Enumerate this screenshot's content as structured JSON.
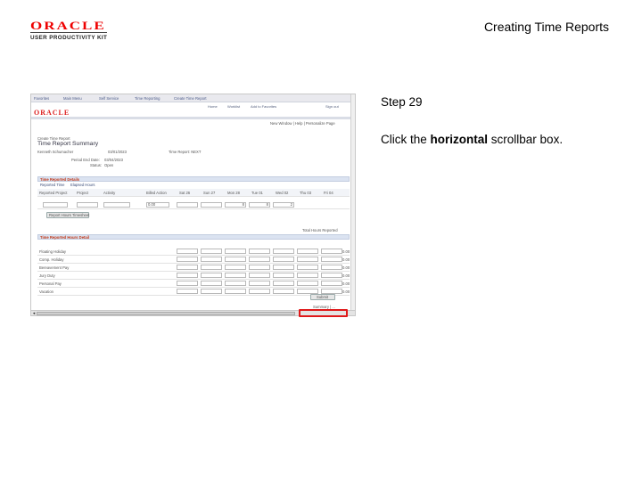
{
  "header": {
    "logo_word": "ORACLE",
    "logo_sub": "USER PRODUCTIVITY KIT",
    "title": "Creating Time Reports"
  },
  "step": {
    "title": "Step 29",
    "instruction_before": "Click the ",
    "instruction_bold": "horizontal",
    "instruction_after": " scrollbar box."
  },
  "screenshot": {
    "nav": [
      "Favorites",
      "Main Menu",
      "Self Service",
      "Time Reporting",
      "Create Time Report"
    ],
    "toplinks": [
      "Home",
      "Worklist",
      "Add to Favorites",
      "Sign out"
    ],
    "logo_word": "ORACLE",
    "utility_links": "New Window | Help | Personalize Page",
    "breadcrumb": "Create Time Report",
    "page_title": "Time Report Summary",
    "employee_name": "Kenneth Schumacher",
    "date_label": "03/01/2023",
    "report_label": "Time Report: NEXT",
    "period_label": "Period End Date:",
    "period_value": "03/04/2023",
    "status_label": "Status:",
    "status_value": "Open",
    "details_header": "Time Reported Details",
    "tabs": [
      "Reported Time",
      "Elapsed Hours"
    ],
    "columns": [
      "Reported Project",
      "Project",
      "Activity",
      "Billed Action",
      "Sat 26",
      "Sun 27",
      "Mon 28",
      "Tue 01",
      "Wed 02",
      "Thu 03",
      "Fri 04"
    ],
    "row_values": [
      "0.00",
      "8",
      "8",
      "2"
    ],
    "add_button": "Report Hours Timesheet",
    "total_label": "Total Hours Reported",
    "hours_header": "Time Reported Hours Detail",
    "hour_rows": [
      "Floating Holiday",
      "Comp. Holiday",
      "Bereavement Pay",
      "Jury Duty",
      "Personal Pay",
      "Vacation"
    ],
    "hour_totals": [
      "0.00",
      "0.00",
      "0.00",
      "0.00",
      "0.00",
      "0.00"
    ],
    "submit_button": "Submit",
    "bottom_link": "Summary  |  ..."
  }
}
